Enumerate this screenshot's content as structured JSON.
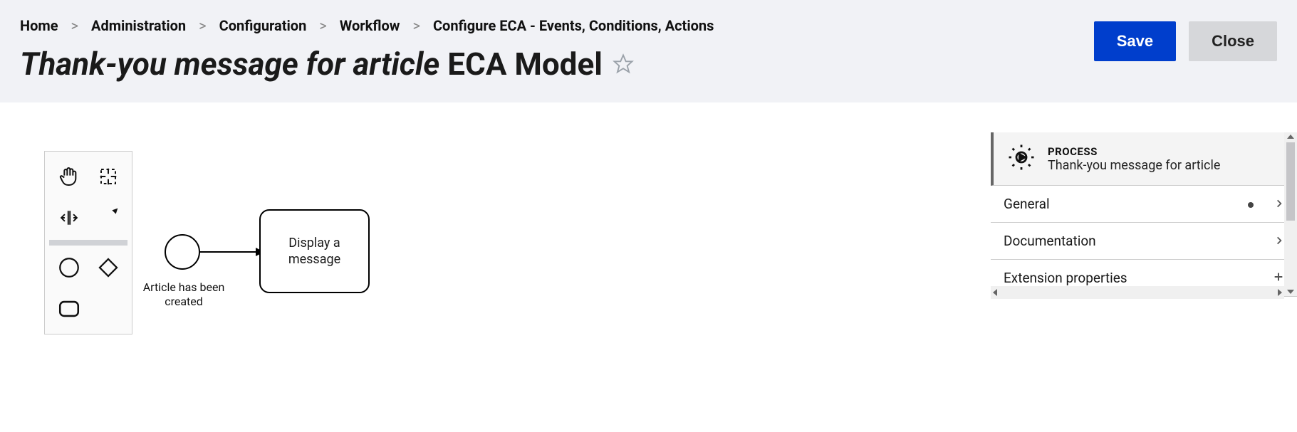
{
  "breadcrumb": {
    "items": [
      {
        "label": "Home"
      },
      {
        "label": "Administration"
      },
      {
        "label": "Configuration"
      },
      {
        "label": "Workflow"
      },
      {
        "label": "Configure ECA - Events, Conditions, Actions"
      }
    ],
    "separator": ">"
  },
  "title": {
    "model_name": "Thank-you message for article",
    "suffix": "ECA Model"
  },
  "actions": {
    "save": "Save",
    "close": "Close"
  },
  "palette": {
    "tools": [
      "hand-tool",
      "lasso-tool",
      "space-tool",
      "global-connect-tool",
      "start-event",
      "gateway",
      "task"
    ]
  },
  "canvas": {
    "start_event": {
      "label": "Article has been created"
    },
    "task": {
      "label": "Display a message"
    }
  },
  "properties": {
    "type_label": "PROCESS",
    "name": "Thank-you message for article",
    "sections": [
      {
        "label": "General",
        "has_dot": true,
        "action_icon": "chevron"
      },
      {
        "label": "Documentation",
        "has_dot": false,
        "action_icon": "chevron"
      },
      {
        "label": "Extension properties",
        "has_dot": false,
        "action_icon": "plus"
      }
    ]
  }
}
